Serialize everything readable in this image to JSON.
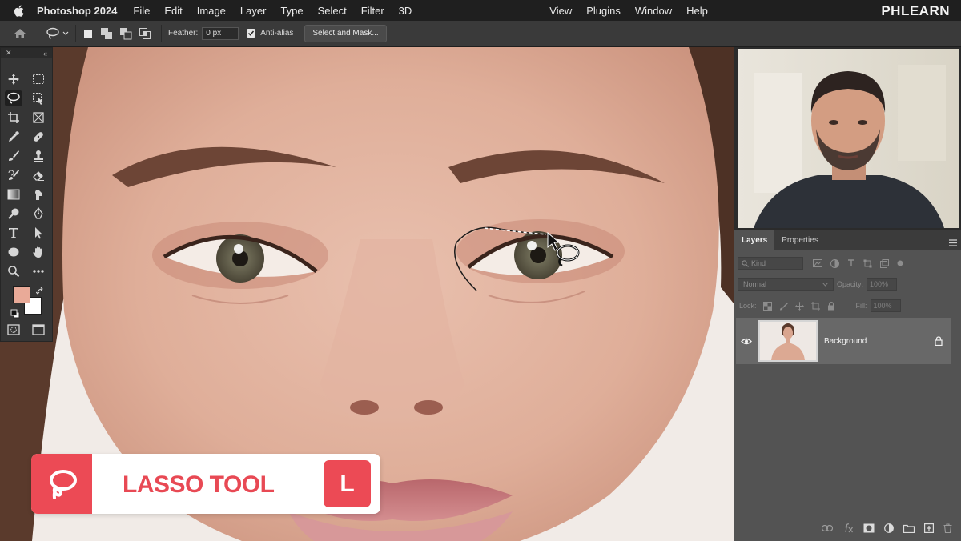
{
  "menubar": {
    "app_name": "Photoshop 2024",
    "left_items": [
      "File",
      "Edit",
      "Image",
      "Layer",
      "Type",
      "Select",
      "Filter",
      "3D"
    ],
    "right_items": [
      "View",
      "Plugins",
      "Window",
      "Help"
    ],
    "brand": "PHLEARN"
  },
  "options_bar": {
    "feather_label": "Feather:",
    "feather_value": "0 px",
    "antialias_label": "Anti-alias",
    "antialias_checked": true,
    "select_mask_label": "Select and Mask..."
  },
  "toolbox": {
    "active_tool": "lasso",
    "foreground_color": "#e9aa98",
    "background_color": "#ffffff"
  },
  "lower_third": {
    "title": "LASSO TOOL",
    "shortcut": "L",
    "accent_color": "#ec4a55"
  },
  "layers_panel": {
    "tabs": [
      "Layers",
      "Properties"
    ],
    "active_tab": "Layers",
    "filter_placeholder": "Kind",
    "blend_mode": "Normal",
    "opacity_label": "Opacity:",
    "opacity_value": "100%",
    "lock_label": "Lock:",
    "fill_label": "Fill:",
    "fill_value": "100%",
    "layers": [
      {
        "name": "Background",
        "visible": true,
        "locked": true
      }
    ]
  }
}
